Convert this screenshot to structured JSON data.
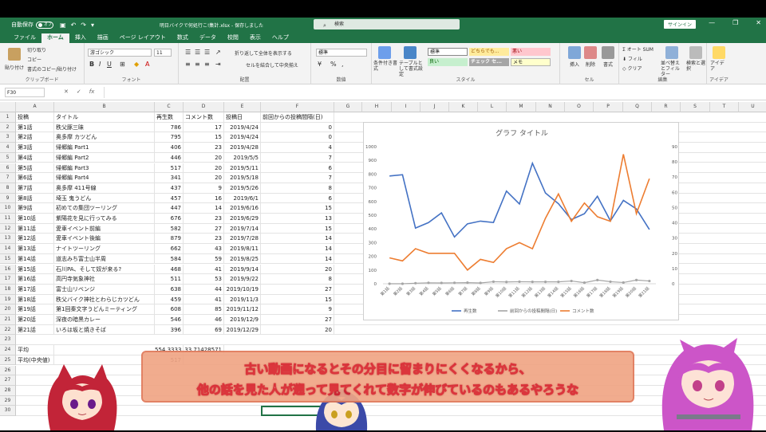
{
  "window": {
    "autosave": "自動保存",
    "autosave_state": "オフ",
    "title": "明日バイクで何処行こ!集計.xlsx - 保存しました",
    "search_placeholder": "検索",
    "signin": "サインイン"
  },
  "menu": [
    {
      "label": "ファイル",
      "key": ""
    },
    {
      "label": "ホーム",
      "key": "H"
    },
    {
      "label": "挿入",
      "key": "N"
    },
    {
      "label": "描画",
      "key": "JI"
    },
    {
      "label": "ページ レイアウト",
      "key": "P"
    },
    {
      "label": "数式",
      "key": "M"
    },
    {
      "label": "データ",
      "key": "A"
    },
    {
      "label": "校閲",
      "key": "R"
    },
    {
      "label": "表示",
      "key": "W"
    },
    {
      "label": "ヘルプ",
      "key": "Y2"
    }
  ],
  "ribbon": {
    "clipboard": {
      "paste": "貼り付け",
      "cut": "切り取り",
      "copy": "コピー",
      "format_painter": "書式のコピー/貼り付け",
      "label": "クリップボード"
    },
    "font": {
      "name": "游ゴシック",
      "size": "11",
      "label": "フォント"
    },
    "alignment": {
      "wrap": "折り返して全体を表示する",
      "merge": "セルを結合して中央揃え",
      "label": "配置"
    },
    "number": {
      "format": "標準",
      "label": "数値"
    },
    "styles": {
      "conditional": "条件付き書式",
      "table": "テーブルとして書式設定",
      "standard": "標準",
      "good": "良い",
      "neutral": "どちらでも...",
      "bad": "悪い",
      "check": "チェック セ...",
      "memo": "メモ",
      "label": "スタイル"
    },
    "cells": {
      "insert": "挿入",
      "delete": "削除",
      "format": "書式",
      "label": "セル"
    },
    "editing": {
      "autosum": "オート SUM",
      "fill": "フィル",
      "clear": "クリア",
      "sort": "並べ替えとフィルター",
      "find": "検索と選択",
      "label": "編集"
    },
    "ideas": {
      "btn": "アイデア",
      "label": "アイデア"
    }
  },
  "formula": {
    "namebox": "F30",
    "cancel": "✕",
    "enter": "✓",
    "fx": "fx"
  },
  "columns": [
    "A",
    "B",
    "C",
    "D",
    "E",
    "F",
    "G",
    "H",
    "I",
    "J",
    "K",
    "L",
    "M",
    "N",
    "O",
    "P",
    "Q",
    "R",
    "S",
    "T",
    "U"
  ],
  "rows": [
    "1",
    "2",
    "3",
    "4",
    "5",
    "6",
    "7",
    "8",
    "9",
    "10",
    "11",
    "12",
    "13",
    "14",
    "15",
    "16",
    "17",
    "18",
    "19",
    "20",
    "21",
    "22",
    "23",
    "24",
    "25",
    "26",
    "27",
    "28",
    "29",
    "30"
  ],
  "headers": [
    "投稿",
    "タイトル",
    "再生数",
    "コメント数",
    "投稿日",
    "前回からの投稿間隔(日)"
  ],
  "table": [
    [
      "第1話",
      "秩父豚三昧",
      "786",
      "17",
      "2019/4/24",
      "0"
    ],
    [
      "第2話",
      "奥多摩 カツどん",
      "795",
      "15",
      "2019/4/24",
      "0"
    ],
    [
      "第3話",
      "帰郷編 Part1",
      "406",
      "23",
      "2019/4/28",
      "4"
    ],
    [
      "第4話",
      "帰郷編 Part2",
      "446",
      "20",
      "2019/5/5",
      "7"
    ],
    [
      "第5話",
      "帰郷編 Part3",
      "517",
      "20",
      "2019/5/11",
      "6"
    ],
    [
      "第6話",
      "帰郷編 Part4",
      "341",
      "20",
      "2019/5/18",
      "7"
    ],
    [
      "第7話",
      "奥多摩 411号線",
      "437",
      "9",
      "2019/5/26",
      "8"
    ],
    [
      "第8話",
      "埼玉 鬼うどん",
      "457",
      "16",
      "2019/6/1",
      "6"
    ],
    [
      "第9話",
      "初めての集団ツーリング",
      "447",
      "14",
      "2019/6/16",
      "15"
    ],
    [
      "第10話",
      "紫陽花を見に行ってみる",
      "676",
      "23",
      "2019/6/29",
      "13"
    ],
    [
      "第11話",
      "愛車イベント前編",
      "582",
      "27",
      "2019/7/14",
      "15"
    ],
    [
      "第12話",
      "愛車イベント後編",
      "879",
      "23",
      "2019/7/28",
      "14"
    ],
    [
      "第13話",
      "ナイトツーリング",
      "662",
      "43",
      "2019/8/11",
      "14"
    ],
    [
      "第14話",
      "道志みち富士山半周",
      "584",
      "59",
      "2019/8/25",
      "14"
    ],
    [
      "第15話",
      "石川PA、そして奴が来る?",
      "468",
      "41",
      "2019/9/14",
      "20"
    ],
    [
      "第16話",
      "高円寺気象神社",
      "511",
      "53",
      "2019/9/22",
      "8"
    ],
    [
      "第17話",
      "富士山リベンジ",
      "638",
      "44",
      "2019/10/19",
      "27"
    ],
    [
      "第18話",
      "秩父バイク神社とわらじカツどん",
      "459",
      "41",
      "2019/11/3",
      "15"
    ],
    [
      "第19話",
      "第1回秦文字うどんミーティング",
      "608",
      "85",
      "2019/11/12",
      "9"
    ],
    [
      "第20話",
      "深夜の暗黒カレー",
      "546",
      "46",
      "2019/12/9",
      "27"
    ],
    [
      "第21話",
      "いろは坂と焼きそば",
      "396",
      "69",
      "2019/12/29",
      "20"
    ]
  ],
  "summary": {
    "avg_label": "平均",
    "avg_views": "554.3333",
    "avg_comments": "33.71428571",
    "median_label": "平均(中央値)",
    "median_views": "517"
  },
  "chart_data": {
    "type": "line",
    "title": "グラフ タイトル",
    "categories": [
      "第1話",
      "第2話",
      "第3話",
      "第4話",
      "第5話",
      "第6話",
      "第7話",
      "第8話",
      "第9話",
      "第10話",
      "第11話",
      "第12話",
      "第13話",
      "第14話",
      "第15話",
      "第16話",
      "第17話",
      "第18話",
      "第19話",
      "第20話",
      "第21話"
    ],
    "series": [
      {
        "name": "再生数",
        "axis": "left",
        "color": "#4472c4",
        "values": [
          786,
          795,
          406,
          446,
          517,
          341,
          437,
          457,
          447,
          676,
          582,
          879,
          662,
          584,
          468,
          511,
          638,
          459,
          608,
          546,
          396
        ]
      },
      {
        "name": "前回からの投稿間隔(日)",
        "axis": "left",
        "color": "#a5a5a5",
        "values": [
          0,
          0,
          4,
          7,
          6,
          7,
          8,
          6,
          15,
          13,
          15,
          14,
          14,
          14,
          20,
          8,
          27,
          15,
          9,
          27,
          20
        ]
      },
      {
        "name": "コメント数",
        "axis": "right",
        "color": "#ed7d31",
        "values": [
          17,
          15,
          23,
          20,
          20,
          20,
          9,
          16,
          14,
          23,
          27,
          23,
          43,
          59,
          41,
          53,
          44,
          41,
          85,
          46,
          69
        ]
      }
    ],
    "yleft": {
      "min": 0,
      "max": 1000,
      "ticks": [
        "0",
        "100",
        "200",
        "300",
        "400",
        "500",
        "600",
        "700",
        "800",
        "900",
        "1000"
      ]
    },
    "yright": {
      "min": 0,
      "max": 90,
      "ticks": [
        "0",
        "10",
        "20",
        "30",
        "40",
        "50",
        "60",
        "70",
        "80",
        "90"
      ]
    },
    "legend": "bottom",
    "grid": false
  },
  "subtitle": {
    "line1": "古い動画になるとその分目に留まりにくくなるから、",
    "line2": "他の話を見た人が遡って見てくれて数字が伸びているのもあるやろうな"
  }
}
